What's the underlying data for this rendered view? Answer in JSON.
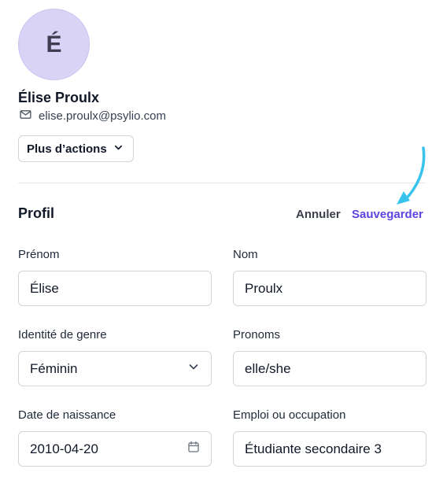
{
  "profile": {
    "avatar_initial": "É",
    "name": "Élise Proulx",
    "email": "elise.proulx@psylio.com",
    "actions_label": "Plus d’actions"
  },
  "section": {
    "title": "Profil",
    "cancel_label": "Annuler",
    "save_label": "Sauvegarder"
  },
  "form": {
    "first_name": {
      "label": "Prénom",
      "value": "Élise"
    },
    "last_name": {
      "label": "Nom",
      "value": "Proulx"
    },
    "gender": {
      "label": "Identité de genre",
      "value": "Féminin"
    },
    "pronouns": {
      "label": "Pronoms",
      "value": "elle/she"
    },
    "birthdate": {
      "label": "Date de naissance",
      "value": "2010-04-20"
    },
    "occupation": {
      "label": "Emploi ou occupation",
      "value": "Étudiante secondaire 3"
    }
  },
  "colors": {
    "accent": "#5b45e0",
    "avatar_bg": "#d9d3f6",
    "annotation_arrow": "#38c3ec"
  }
}
